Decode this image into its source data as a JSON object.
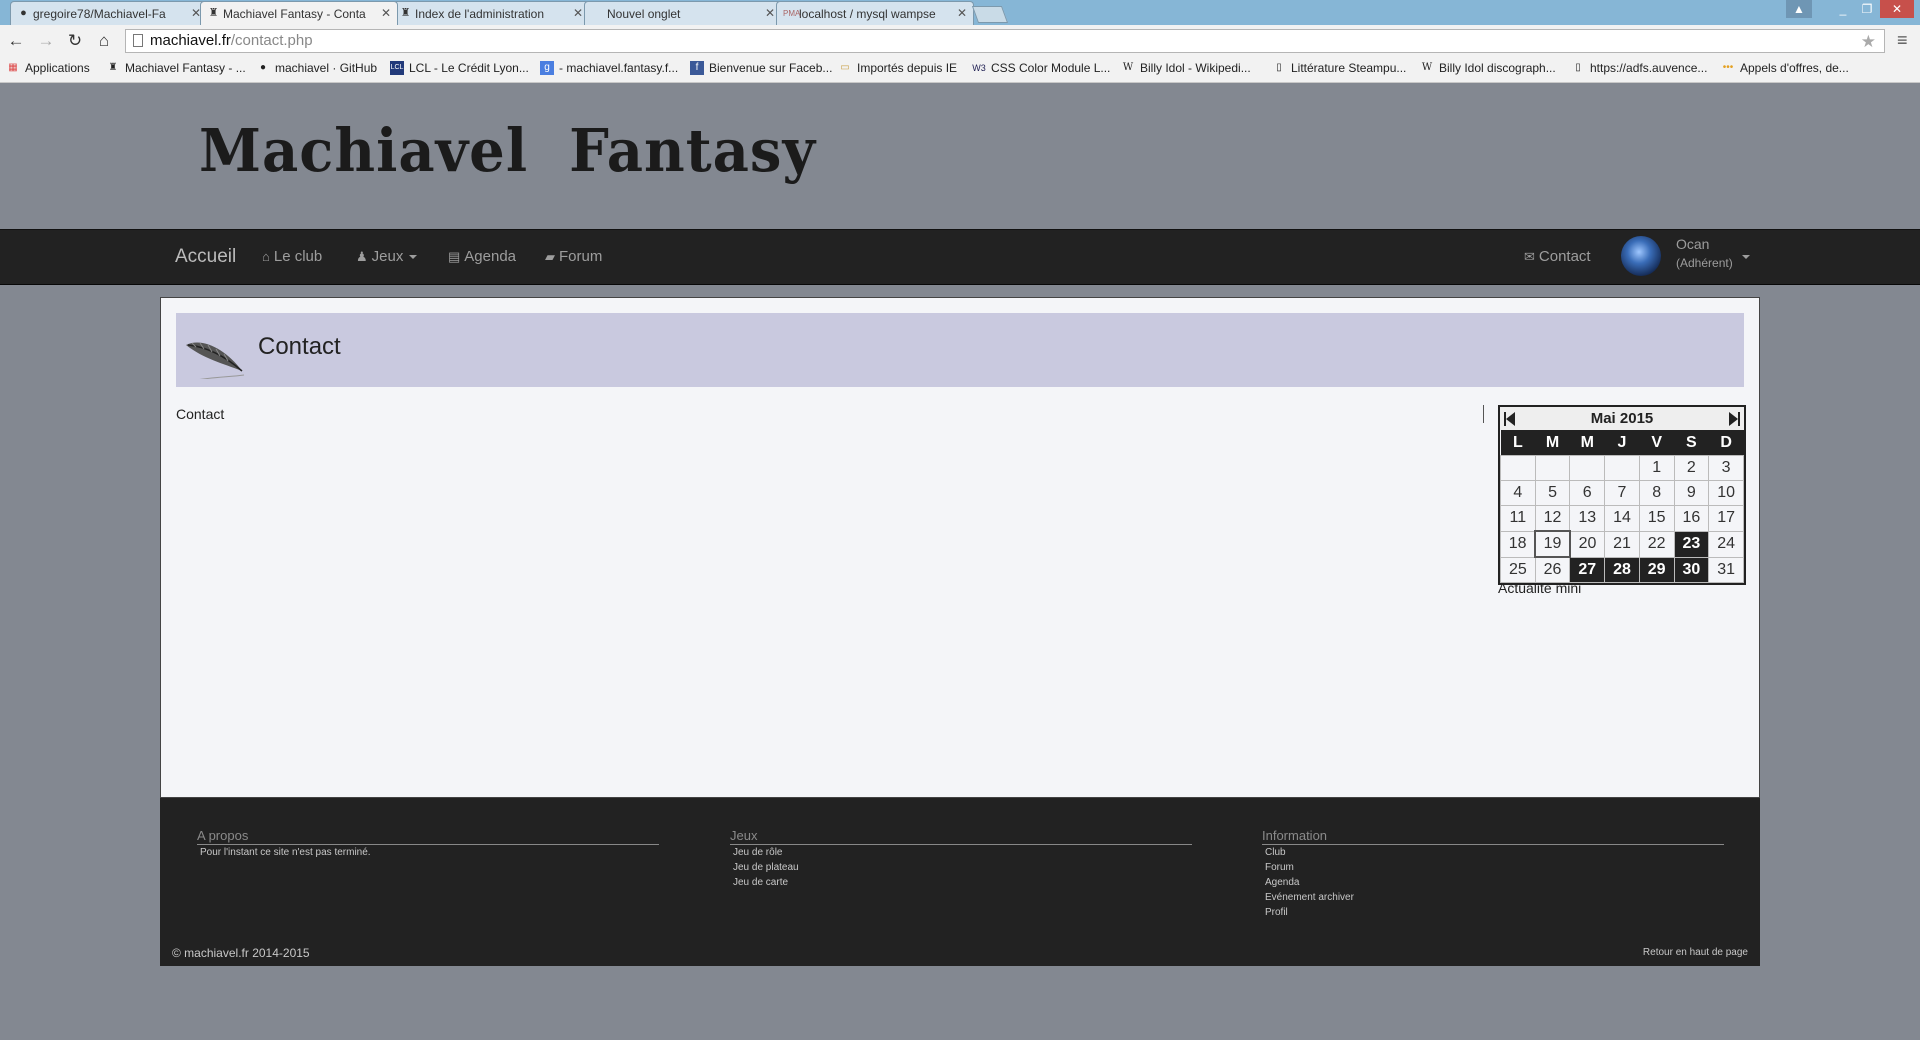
{
  "browser": {
    "tabs": [
      {
        "title": "gregoire78/Machiavel-Fa",
        "icon": "github-icon"
      },
      {
        "title": "Machiavel Fantasy - Conta",
        "icon": "machiavel-favicon"
      },
      {
        "title": "Index de l'administration",
        "icon": "machiavel-favicon"
      },
      {
        "title": "Nouvel onglet",
        "icon": "none"
      },
      {
        "title": "localhost / mysql wampse",
        "icon": "phpmyadmin-icon"
      }
    ],
    "url_host": "machiavel.fr",
    "url_path": "/contact.php",
    "bookmarks": [
      "Applications",
      "Machiavel Fantasy - ...",
      "machiavel · GitHub",
      "LCL - Le Crédit Lyon...",
      "- machiavel.fantasy.f...",
      "Bienvenue sur Faceb...",
      "Importés depuis IE",
      "CSS Color Module L...",
      "Billy Idol - Wikipedi...",
      "Littérature Steampu...",
      "Billy Idol discograph...",
      "https://adfs.auvence...",
      "Appels d'offres, de..."
    ]
  },
  "site": {
    "logo": "Machiavel  Fantasy",
    "nav": {
      "brand": "Accueil",
      "club": "Le club",
      "jeux": "Jeux",
      "agenda": "Agenda",
      "forum": "Forum",
      "contact": "Contact"
    },
    "user": {
      "name": "Ocan",
      "role": "(Adhérent)"
    },
    "page_title": "Contact",
    "body_text": "Contact",
    "calendar": {
      "title": "Mai 2015",
      "weekdays": [
        "L",
        "M",
        "M",
        "J",
        "V",
        "S",
        "D"
      ],
      "weeks": [
        [
          "",
          "",
          "",
          "",
          "1",
          "2",
          "3"
        ],
        [
          "4",
          "5",
          "6",
          "7",
          "8",
          "9",
          "10"
        ],
        [
          "11",
          "12",
          "13",
          "14",
          "15",
          "16",
          "17"
        ],
        [
          "18",
          "19",
          "20",
          "21",
          "22",
          "23",
          "24"
        ],
        [
          "25",
          "26",
          "27",
          "28",
          "29",
          "30",
          "31"
        ]
      ],
      "event_days": [
        "23",
        "27",
        "28",
        "29",
        "30"
      ],
      "today": "19",
      "caption": "Actualité mini"
    },
    "footer": {
      "apropos": {
        "title": "A propos",
        "text": "Pour l'instant ce site n'est pas terminé."
      },
      "jeux": {
        "title": "Jeux",
        "links": [
          "Jeu de rôle",
          "Jeu de plateau",
          "Jeu de carte"
        ]
      },
      "information": {
        "title": "Information",
        "links": [
          "Club",
          "Forum",
          "Agenda",
          "Evénement archiver",
          "Profil"
        ]
      },
      "copyright": "© machiavel.fr 2014-2015",
      "back_to_top": "Retour en haut de page"
    }
  }
}
